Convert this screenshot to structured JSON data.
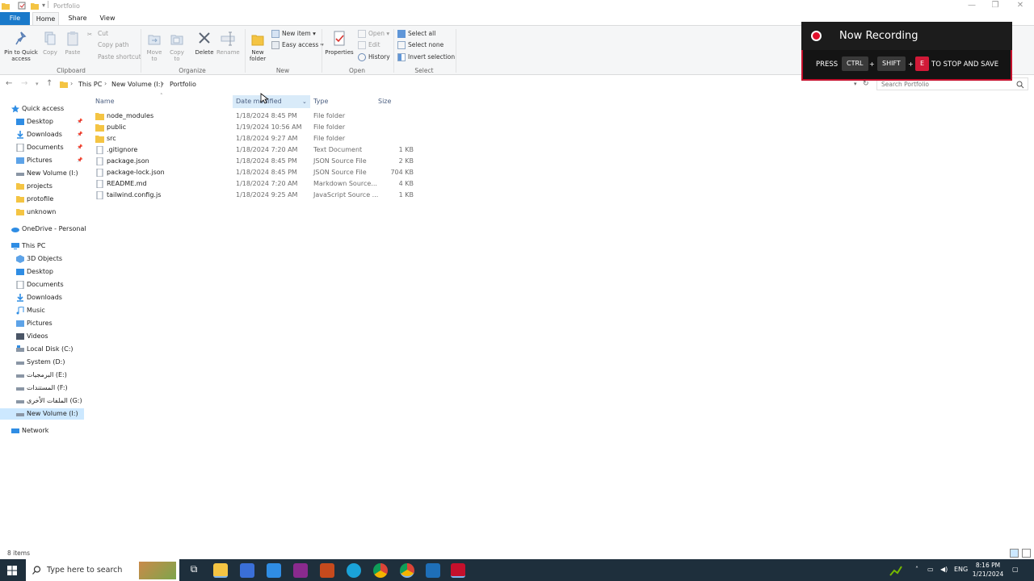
{
  "window": {
    "title": "Portfolio",
    "controls": {
      "minimize": "—",
      "maximize": "❐",
      "close": "✕"
    }
  },
  "ribbon": {
    "tabs": [
      {
        "label": "File"
      },
      {
        "label": "Home"
      },
      {
        "label": "Share"
      },
      {
        "label": "View"
      }
    ],
    "clipboard": {
      "group_label": "Clipboard",
      "pin_label": "Pin to Quick access",
      "copy_label": "Copy",
      "paste_label": "Paste",
      "cut_label": "Cut",
      "copy_path_label": "Copy path",
      "paste_shortcut_label": "Paste shortcut"
    },
    "organize": {
      "group_label": "Organize",
      "move_to_label": "Move to",
      "copy_to_label": "Copy to",
      "delete_label": "Delete",
      "rename_label": "Rename"
    },
    "new": {
      "group_label": "New",
      "new_folder_label": "New folder",
      "new_item_label": "New item",
      "easy_access_label": "Easy access"
    },
    "open": {
      "group_label": "Open",
      "properties_label": "Properties",
      "open_label": "Open",
      "edit_label": "Edit",
      "history_label": "History"
    },
    "select": {
      "group_label": "Select",
      "select_all_label": "Select all",
      "select_none_label": "Select none",
      "invert_label": "Invert selection"
    }
  },
  "address": {
    "crumbs": [
      "This PC",
      "New Volume (I:)",
      "Portfolio"
    ],
    "search_placeholder": "Search Portfolio"
  },
  "nav": {
    "quick_access": "Quick access",
    "quick_items": [
      "Desktop",
      "Downloads",
      "Documents",
      "Pictures",
      "New Volume (I:)",
      "projects",
      "protofile",
      "unknown"
    ],
    "onedrive": "OneDrive - Personal",
    "this_pc": "This PC",
    "pc_items": [
      "3D Objects",
      "Desktop",
      "Documents",
      "Downloads",
      "Music",
      "Pictures",
      "Videos",
      "Local Disk (C:)",
      "System (D:)",
      "البرمجيات (E:)",
      "المستندات (F:)",
      "الملفات الأخرى (G:)",
      "New Volume (I:)"
    ],
    "network": "Network"
  },
  "columns": {
    "name": "Name",
    "date": "Date modified",
    "type": "Type",
    "size": "Size"
  },
  "files": [
    {
      "name": "node_modules",
      "date": "1/18/2024 8:45 PM",
      "type": "File folder",
      "size": "",
      "kind": "folder"
    },
    {
      "name": "public",
      "date": "1/19/2024 10:56 AM",
      "type": "File folder",
      "size": "",
      "kind": "folder"
    },
    {
      "name": "src",
      "date": "1/18/2024 9:27 AM",
      "type": "File folder",
      "size": "",
      "kind": "folder"
    },
    {
      "name": ".gitignore",
      "date": "1/18/2024 7:20 AM",
      "type": "Text Document",
      "size": "1 KB",
      "kind": "file"
    },
    {
      "name": "package.json",
      "date": "1/18/2024 8:45 PM",
      "type": "JSON Source File",
      "size": "2 KB",
      "kind": "file"
    },
    {
      "name": "package-lock.json",
      "date": "1/18/2024 8:45 PM",
      "type": "JSON Source File",
      "size": "704 KB",
      "kind": "file"
    },
    {
      "name": "README.md",
      "date": "1/18/2024 7:20 AM",
      "type": "Markdown Source...",
      "size": "4 KB",
      "kind": "file"
    },
    {
      "name": "tailwind.config.js",
      "date": "1/18/2024 9:25 AM",
      "type": "JavaScript Source ...",
      "size": "1 KB",
      "kind": "file"
    }
  ],
  "status": {
    "items_count": "8 items"
  },
  "taskbar": {
    "search_placeholder": "Type here to search",
    "lang": "ENG",
    "time": "8:16 PM",
    "date": "1/21/2024"
  },
  "recording": {
    "title": "Now Recording",
    "press": "PRESS",
    "key1": "CTRL",
    "key2": "SHIFT",
    "key3": "E",
    "plus": "+",
    "suffix": "TO STOP AND SAVE"
  },
  "colors": {
    "accent": "#1979ca",
    "selection": "#cce8ff",
    "folder": "#f4c443",
    "taskbar": "#1e2f3c",
    "recording_red": "#c5102c"
  }
}
